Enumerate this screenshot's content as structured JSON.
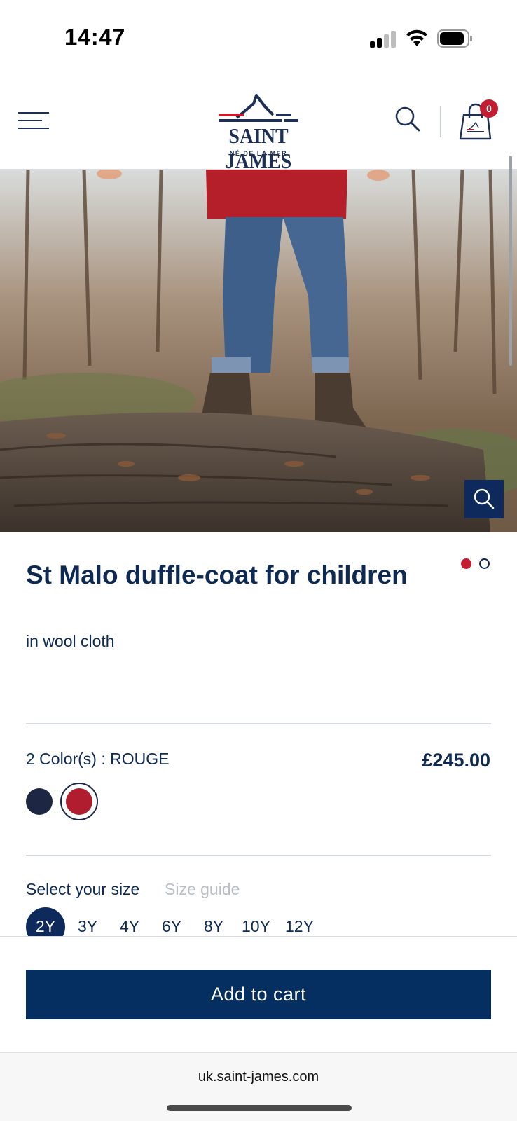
{
  "status_bar": {
    "time": "14:47",
    "signal_icon": "cellular-signal-icon",
    "wifi_icon": "wifi-icon",
    "battery_icon": "battery-icon"
  },
  "header": {
    "menu_icon": "hamburger-menu-icon",
    "brand": "SAINT JAMES",
    "brand_tagline": "NÉ DE LA MER",
    "search_icon": "search-icon",
    "cart_icon": "shopping-bag-icon",
    "cart_count": "0"
  },
  "product": {
    "image_alt": "Child wearing red duffle-coat, jeans and brown boots standing on a log in a forest",
    "zoom_icon": "zoom-icon",
    "title": "St Malo duffle-coat for children",
    "subtitle": "in wool cloth",
    "image_dots": {
      "count": 2,
      "active": 0
    },
    "colors_label": "2 Color(s) : ROUGE",
    "price": "£245.00",
    "colors": [
      {
        "name": "navy",
        "hex": "#1d2744",
        "selected": false
      },
      {
        "name": "ROUGE",
        "hex": "#b01d2e",
        "selected": true
      }
    ],
    "size_label": "Select your size",
    "size_guide": "Size guide",
    "sizes": [
      "2Y",
      "3Y",
      "4Y",
      "6Y",
      "8Y",
      "10Y",
      "12Y"
    ],
    "selected_size": "2Y"
  },
  "cta": {
    "add_to_cart": "Add to cart"
  },
  "browser": {
    "url": "uk.saint-james.com"
  },
  "colors": {
    "brand_navy": "#0e2a52",
    "button_navy": "#052f61",
    "accent_red": "#c41c30"
  }
}
